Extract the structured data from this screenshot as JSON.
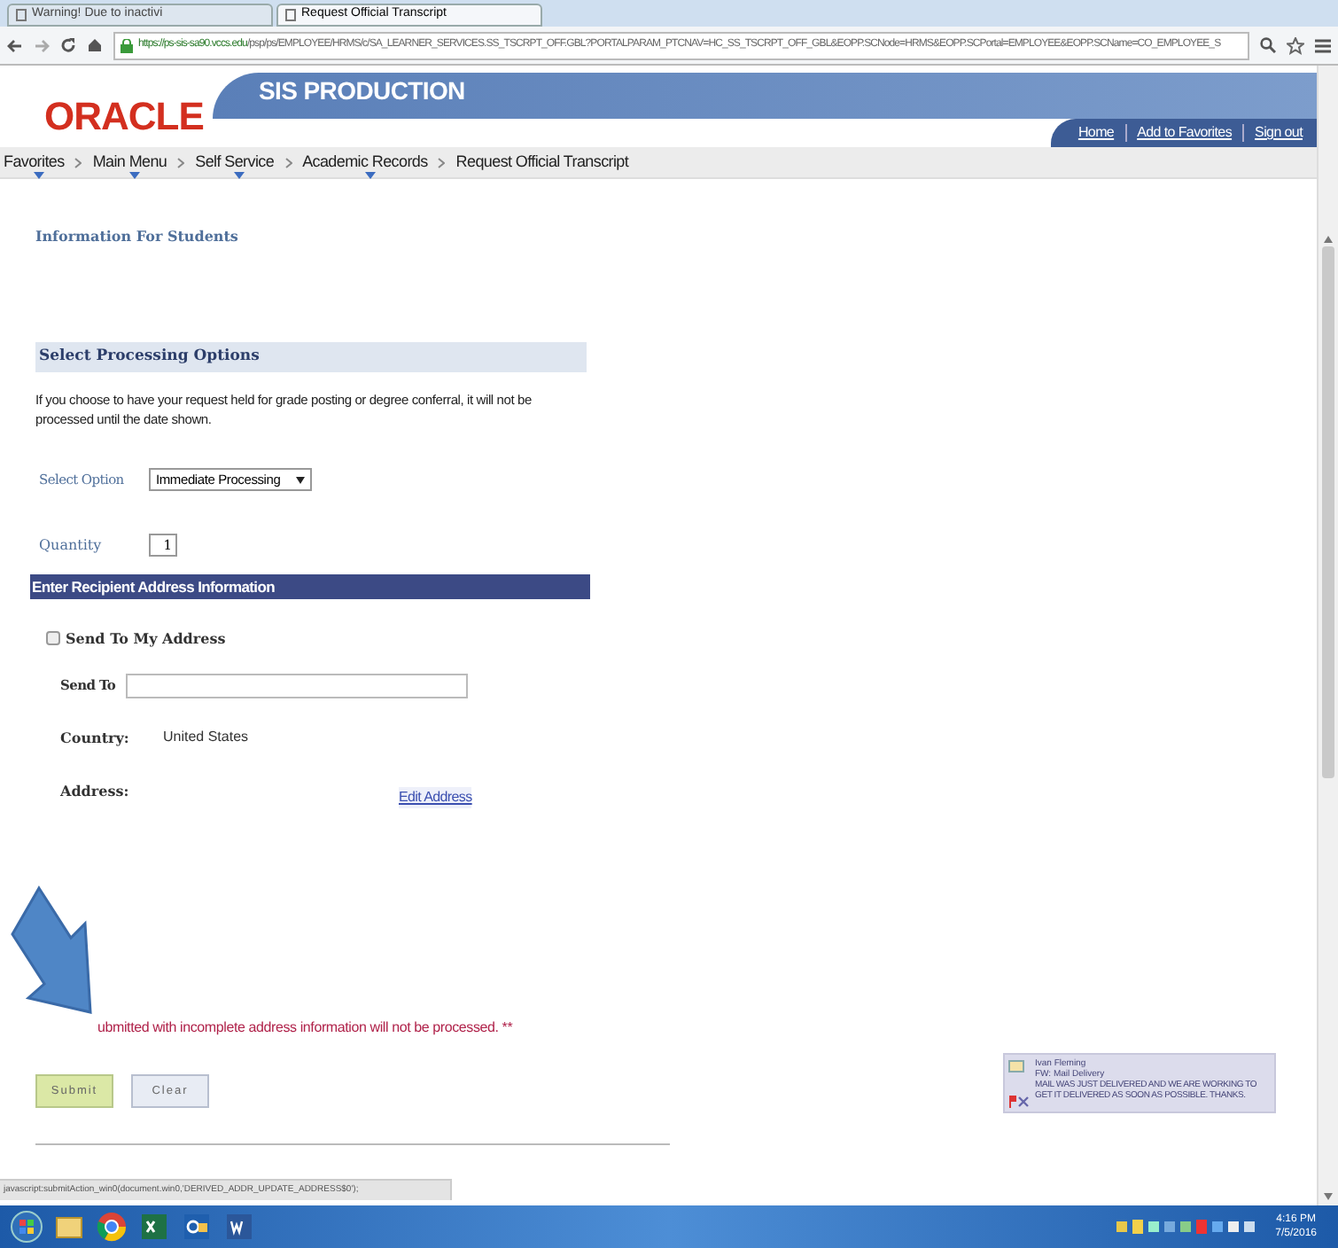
{
  "browser": {
    "tabs": [
      {
        "label": "Warning! Due to inactivi",
        "selected": false
      },
      {
        "label": "Request Official Transcript",
        "selected": true
      }
    ],
    "url_host": "https://ps-sis-sa90.vccs.edu",
    "url_path": "/psp/ps/EMPLOYEE/HRMS/c/SA_LEARNER_SERVICES.SS_TSCRPT_OFF.GBL?PORTALPARAM_PTCNAV=HC_SS_TSCRPT_OFF_GBL&EOPP.SCNode=HRMS&EOPP.SCPortal=EMPLOYEE&EOPP.SCName=CO_EMPLOYEE_S"
  },
  "header": {
    "logo": "ORACLE",
    "title": "SIS PRODUCTION",
    "links": [
      "Home",
      "Add to Favorites",
      "Sign out"
    ]
  },
  "breadcrumb": [
    {
      "label": "Favorites",
      "menu": true
    },
    {
      "label": "Main Menu",
      "menu": true
    },
    {
      "label": "Self Service",
      "menu": true
    },
    {
      "label": "Academic Records",
      "menu": true
    },
    {
      "label": "Request Official Transcript",
      "menu": false
    }
  ],
  "info_link": "Information For Students",
  "processing": {
    "heading": "Select Processing Options",
    "note": "If you choose to have your request held for grade posting or degree conferral, it will not be processed until the date shown.",
    "option_label": "Select Option",
    "option_value": "Immediate Processing",
    "quantity_label": "Quantity",
    "quantity_value": "1"
  },
  "recipient": {
    "heading": "Enter Recipient Address Information",
    "send_to_my_address": {
      "label": "Send To My Address",
      "checked": false
    },
    "send_to_label": "Send To",
    "country_label": "Country:",
    "country_value": "United States",
    "address_label": "Address:",
    "edit_link": "Edit Address"
  },
  "warning": "ubmitted with incomplete address information will not be processed. **",
  "buttons": [
    {
      "label": "Submit",
      "kind": "primary"
    },
    {
      "label": "Clear",
      "kind": "secondary"
    }
  ],
  "status_text": "javascript:submitAction_win0(document.win0,'DERIVED_ADDR_UPDATE_ADDRESS$0');",
  "notification": {
    "sender": "Ivan Fleming",
    "subject": "FW: Mail Delivery",
    "lines": [
      "MAIL WAS JUST DELIVERED AND WE ARE WORKING TO",
      "GET IT DELIVERED AS SOON AS POSSIBLE. THANKS."
    ]
  },
  "taskbar": {
    "time": "4:16 PM",
    "date": "7/5/2016"
  }
}
